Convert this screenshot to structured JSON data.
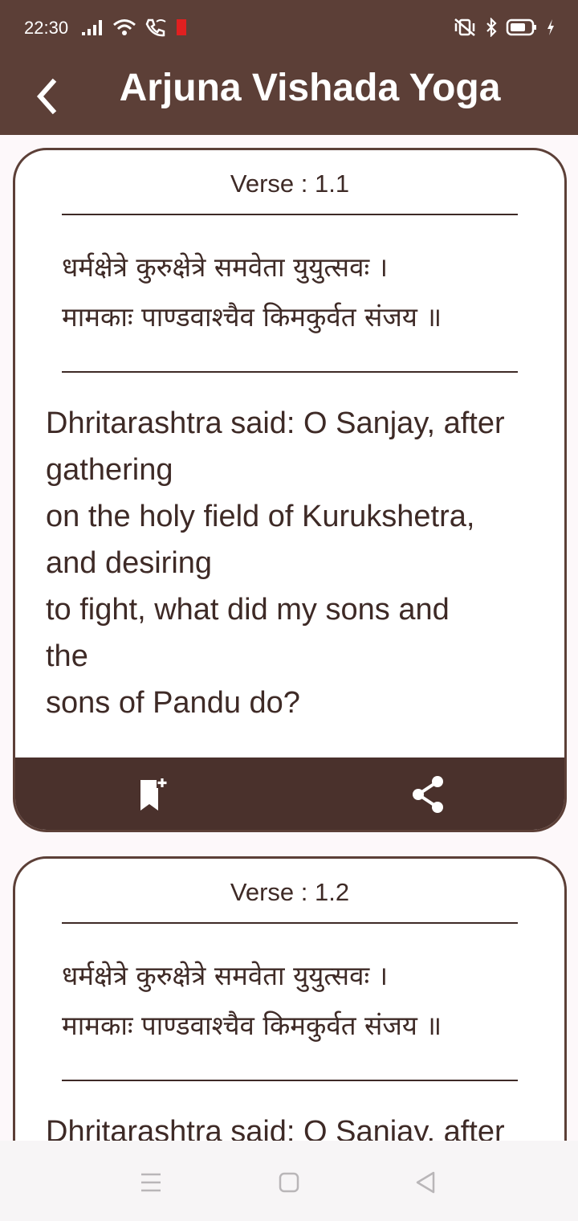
{
  "status_bar": {
    "time": "22:30",
    "icons_left": [
      "signal-icon",
      "wifi-icon",
      "wifi-call-icon",
      "battery-saver-icon"
    ],
    "icons_right": [
      "vibrate-icon",
      "bluetooth-icon",
      "battery-icon",
      "charging-icon"
    ]
  },
  "app_bar": {
    "title": "Arjuna Vishada Yoga",
    "back_icon": "chevron-left-icon"
  },
  "verses": [
    {
      "number": "Verse : 1.1",
      "sanskrit_line1": "धर्मक्षेत्रे कुरुक्षेत्रे समवेता युयुत्सवः ।",
      "sanskrit_line2": "मामकाः पाण्डवाश्चैव किमकुर्वत संजय ॥",
      "translation_lines": [
        "Dhritarashtra said: O Sanjay, after",
        "gathering",
        "on the holy field of Kurukshetra,",
        "and desiring",
        "to fight, what did my sons and",
        "the",
        "sons of Pandu do?"
      ],
      "actions": [
        "bookmark-add-icon",
        "share-icon"
      ]
    },
    {
      "number": "Verse : 1.2",
      "sanskrit_line1": "धर्मक्षेत्रे कुरुक्षेत्रे समवेता युयुत्सवः ।",
      "sanskrit_line2": "मामकाः पाण्डवाश्चैव किमकुर्वत संजय ॥",
      "translation_lines": [
        "Dhritarashtra said: O Sanjay, after"
      ]
    }
  ],
  "nav_bar": {
    "icons": [
      "menu-icon",
      "home-icon",
      "back-icon"
    ]
  },
  "colors": {
    "primary": "#5c3f37",
    "card_footer": "#4a312c",
    "text": "#3e2a26",
    "background": "#fdf8fa"
  }
}
